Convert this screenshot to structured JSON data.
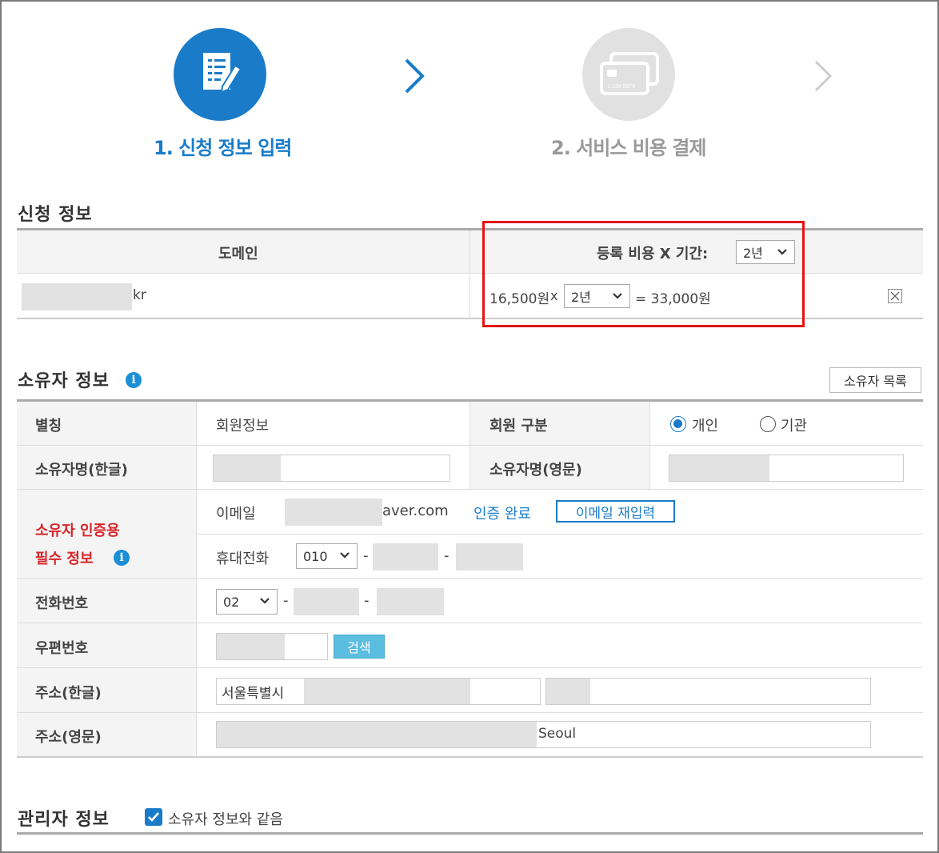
{
  "steps": {
    "step1_label": "1. 신청 정보 입력",
    "step2_label": "2. 서비스 비용 결제",
    "card_number": "1 234 5678"
  },
  "application": {
    "title": "신청 정보",
    "col_domain": "도메인",
    "col_cost": "등록 비용 X 기간:",
    "period_header_select": "2년",
    "domain_suffix": "kr",
    "unit_price": "16,500원",
    "times": "x",
    "period_select": "2년",
    "total": "= 33,000원"
  },
  "owner": {
    "title": "소유자 정보",
    "list_button": "소유자 목록",
    "alias_label": "별칭",
    "alias_value": "회원정보",
    "member_type_label": "회원 구분",
    "type_individual": "개인",
    "type_organization": "기관",
    "name_kr_label": "소유자명(한글)",
    "name_en_label": "소유자명(영문)",
    "auth_label_line1": "소유자 인증용",
    "auth_label_line2": "필수 정보",
    "email_label": "이메일",
    "email_value": "aver.com",
    "auth_done": "인증 완료",
    "email_reenter": "이메일 재입력",
    "mobile_label": "휴대전화",
    "mobile_prefix": "010",
    "dash": "-",
    "phone_label": "전화번호",
    "phone_prefix": "02",
    "zip_label": "우편번호",
    "search_button": "검색",
    "addr_kr_label": "주소(한글)",
    "addr_kr_value": "서울특별시",
    "addr_en_label": "주소(영문)",
    "addr_en_value": "Seoul"
  },
  "admin": {
    "title": "관리자 정보",
    "same_as_owner": "소유자 정보와 같음"
  },
  "colors": {
    "accent": "#1a7cc9",
    "highlight": "#e41414",
    "required": "#d9252a"
  }
}
